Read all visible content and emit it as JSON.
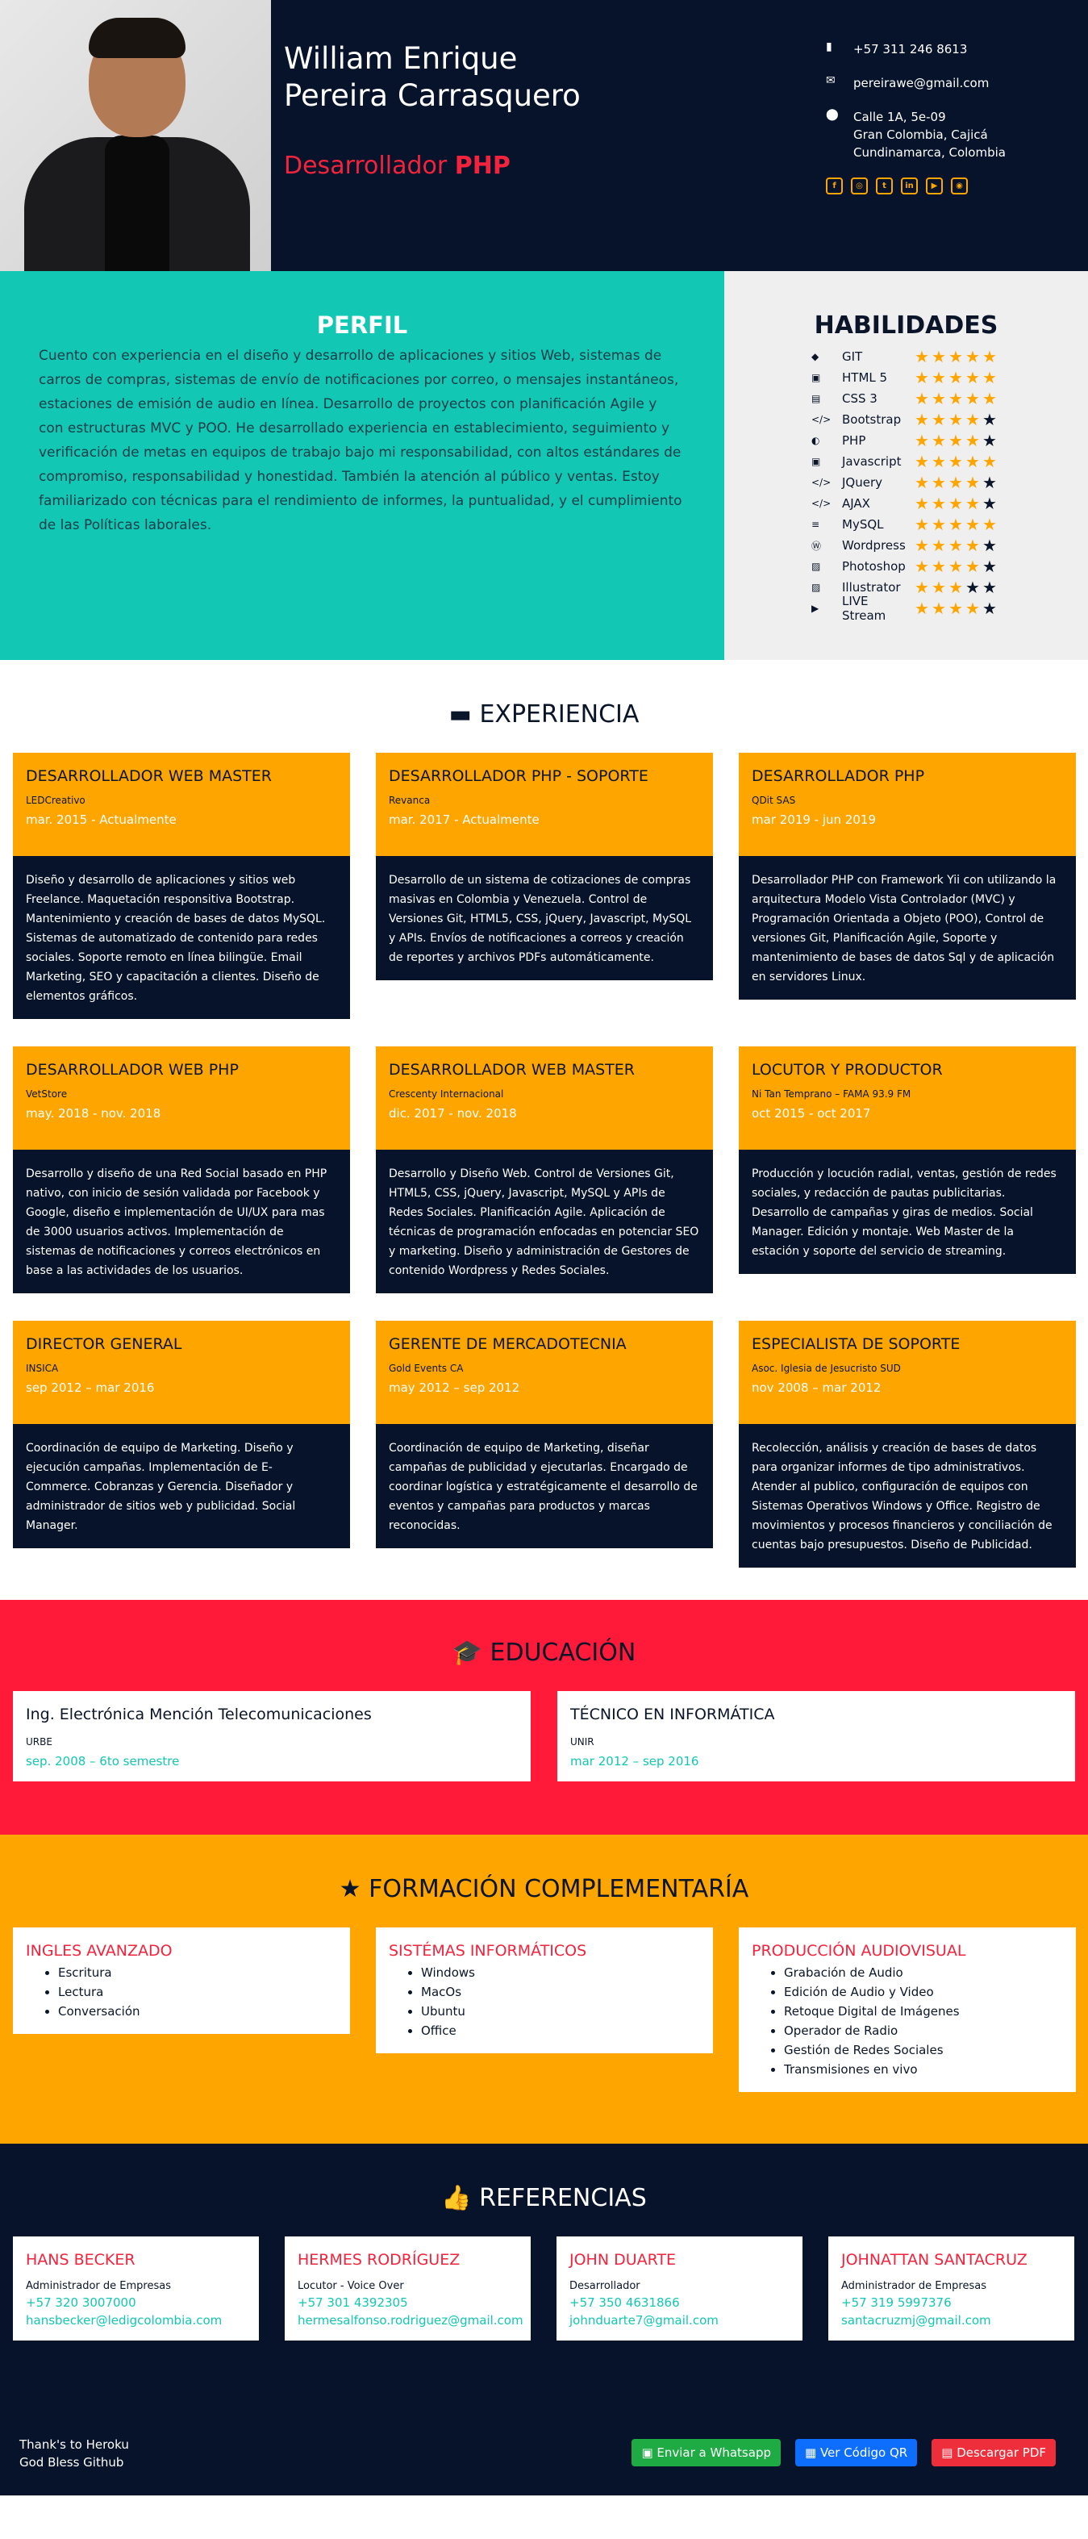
{
  "header": {
    "name_line1": "William Enrique",
    "name_line2": "Pereira Carrasquero",
    "role_prefix": "Desarrollador",
    "role_highlight": "PHP",
    "phone": "+57 311 246 8613",
    "email": "pereirawe@gmail.com",
    "address_line1": "Calle 1A, 5e-09",
    "address_line2": "Gran Colombia, Cajicá",
    "address_line3": "Cundinamarca, Colombia",
    "social_icons": [
      "facebook-icon",
      "instagram-icon",
      "twitter-icon",
      "linkedin-icon",
      "youtube-icon",
      "github-icon"
    ]
  },
  "profile": {
    "title": "PERFIL",
    "text": "Cuento con experiencia en el diseño y desarrollo de aplicaciones y sitios Web, sistemas de carros de compras, sistemas de envío de notificaciones por correo, o mensajes instantáneos, estaciones de emisión de audio en línea. Desarrollo de proyectos con planificación Agile y con estructuras MVC y POO. He desarrollado experiencia en establecimiento, seguimiento y verificación de metas en equipos de trabajo bajo mi responsabilidad, con altos estándares de compromiso, responsabilidad y honestidad. También la atención al público y ventas. Estoy familiarizado con técnicas para el rendimiento de informes, la puntualidad, y el cumplimiento de las Políticas laborales."
  },
  "skills": {
    "title": "HABILIDADES",
    "items": [
      {
        "name": "GIT",
        "rating": 5
      },
      {
        "name": "HTML 5",
        "rating": 5
      },
      {
        "name": "CSS 3",
        "rating": 5
      },
      {
        "name": "Bootstrap",
        "rating": 4
      },
      {
        "name": "PHP",
        "rating": 4
      },
      {
        "name": "Javascript",
        "rating": 5
      },
      {
        "name": "JQuery",
        "rating": 4
      },
      {
        "name": "AJAX",
        "rating": 4
      },
      {
        "name": "MySQL",
        "rating": 5
      },
      {
        "name": "Wordpress",
        "rating": 4
      },
      {
        "name": "Photoshop",
        "rating": 4
      },
      {
        "name": "Illustrator",
        "rating": 3
      },
      {
        "name": "LIVE Stream",
        "rating": 4
      }
    ]
  },
  "experience": {
    "title": "EXPERIENCIA",
    "jobs": [
      {
        "title": "DESARROLLADOR WEB MASTER",
        "company": "LEDCreativo",
        "date": "mar. 2015 - Actualmente",
        "description": "Diseño y desarrollo de aplicaciones y sitios web Freelance. Maquetación responsitiva Bootstrap. Mantenimiento y creación de bases de datos MySQL. Sistemas de automatizado de contenido para redes sociales. Soporte remoto en línea bilingüe. Email Marketing, SEO y capacitación a clientes. Diseño de elementos gráficos."
      },
      {
        "title": "DESARROLLADOR PHP - SOPORTE",
        "company": "Revanca",
        "date": "mar. 2017 - Actualmente",
        "description": "Desarrollo de un sistema de cotizaciones de compras masivas en Colombia y Venezuela. Control de Versiones Git, HTML5, CSS, jQuery, Javascript, MySQL y APIs. Envíos de notificaciones a correos y creación de reportes y archivos PDFs automáticamente."
      },
      {
        "title": "DESARROLLADOR PHP",
        "company": "QDit SAS",
        "date": "mar 2019 - jun 2019",
        "description": "Desarrollador PHP con Framework Yii con utilizando la arquitectura Modelo Vista Controlador (MVC) y Programación Orientada a Objeto (POO), Control de versiones Git, Planificación Agile, Soporte y mantenimiento de bases de datos Sql y de aplicación en servidores Linux."
      },
      {
        "title": "DESARROLLADOR WEB PHP",
        "company": "VetStore",
        "date": "may. 2018 - nov. 2018",
        "description": "Desarrollo y diseño de una Red Social basado en PHP nativo, con inicio de sesión validada por Facebook y Google, diseño e implementación de UI/UX para mas de 3000 usuarios activos. Implementación de sistemas de notificaciones y correos electrónicos en base a las actividades de los usuarios."
      },
      {
        "title": "DESARROLLADOR WEB MASTER",
        "company": "Crescenty Internacional",
        "date": "dic. 2017 - nov. 2018",
        "description": "Desarrollo y Diseño Web. Control de Versiones Git, HTML5, CSS, jQuery, Javascript, MySQL y APIs de Redes Sociales. Planificación Agile. Aplicación de técnicas de programación enfocadas en potenciar SEO y marketing. Diseño y administración de Gestores de contenido Wordpress y Redes Sociales."
      },
      {
        "title": "LOCUTOR Y PRODUCTOR",
        "company": "Ni Tan Temprano – FAMA 93.9 FM",
        "date": "oct 2015 - oct 2017",
        "description": "Producción y locución radial, ventas, gestión de redes sociales, y redacción de pautas publicitarias. Desarrollo de campañas y giras de medios. Social Manager. Edición y montaje. Web Master de la estación y soporte del servicio de streaming."
      },
      {
        "title": "DIRECTOR GENERAL",
        "company": "INSICA",
        "date": "sep 2012 – mar 2016",
        "description": "Coordinación de equipo de Marketing. Diseño y ejecución campañas. Implementación de E-Commerce. Cobranzas y Gerencia. Diseñador y administrador de sitios web y publicidad. Social Manager."
      },
      {
        "title": "GERENTE DE MERCADOTECNIA",
        "company": "Gold Events CA",
        "date": "may 2012 – sep 2012",
        "description": "Coordinación de equipo de Marketing, diseñar campañas de publicidad y ejecutarlas. Encargado de coordinar logística y estratégicamente el desarrollo de eventos y campañas para productos y marcas reconocidas."
      },
      {
        "title": "ESPECIALISTA DE SOPORTE",
        "company": "Asoc. Iglesia de Jesucristo SUD",
        "date": "nov 2008 – mar 2012",
        "description": "Recolección, análisis y creación de bases de datos para organizar informes de tipo administrativos. Atender al publico, configuración de equipos con Sistemas Operativos Windows y Office. Registro de movimientos y procesos financieros y conciliación de cuentas bajo presupuestos. Diseño de Publicidad."
      }
    ]
  },
  "education": {
    "title": "EDUCACIÓN",
    "items": [
      {
        "title": "Ing. Electrónica Mención Telecomunicaciones",
        "school": "URBE",
        "date": "sep. 2008 – 6to semestre"
      },
      {
        "title": "TÉCNICO EN INFORMÁTICA",
        "school": "UNIR",
        "date": "mar 2012 – sep 2016"
      }
    ]
  },
  "complementary": {
    "title": "FORMACIÓN COMPLEMENTARÍA",
    "items": [
      {
        "title": "INGLES AVANZADO",
        "points": [
          "Escritura",
          "Lectura",
          "Conversación"
        ]
      },
      {
        "title": "SISTÉMAS INFORMÁTICOS",
        "points": [
          "Windows",
          "MacOs",
          "Ubuntu",
          "Office"
        ]
      },
      {
        "title": "PRODUCCIÓN AUDIOVISUAL",
        "points": [
          "Grabación de Audio",
          "Edición de Audio y Video",
          "Retoque Digital de Imágenes",
          "Operador de Radio",
          "Gestión de Redes Sociales",
          "Transmisiones en vivo"
        ]
      }
    ]
  },
  "references": {
    "title": "REFERENCIAS",
    "items": [
      {
        "name": "HANS BECKER",
        "job": "Administrador de Empresas",
        "phone": "+57 320 3007000",
        "email": "hansbecker@ledigcolombia.com"
      },
      {
        "name": "HERMES RODRÍGUEZ",
        "job": "Locutor - Voice Over",
        "phone": "+57 301 4392305",
        "email": "hermesalfonso.rodriguez@gmail.com"
      },
      {
        "name": "JOHN DUARTE",
        "job": "Desarrollador",
        "phone": "+57 350 4631866",
        "email": "johnduarte7@gmail.com"
      },
      {
        "name": "JOHNATTAN SANTACRUZ",
        "job": "Administrador de Empresas",
        "phone": "+57 319 5997376",
        "email": "santacruzmj@gmail.com"
      }
    ]
  },
  "footer": {
    "line1": "Thank's to Heroku",
    "line2": "God Bless Github",
    "btn_whatsapp": "Enviar a Whatsapp",
    "btn_qr": "Ver Código QR",
    "btn_pdf": "Descargar PDF"
  },
  "colors": {
    "navy": "#07132a",
    "teal": "#12c7b3",
    "orange": "#ffa500",
    "red": "#ff1a3a"
  }
}
